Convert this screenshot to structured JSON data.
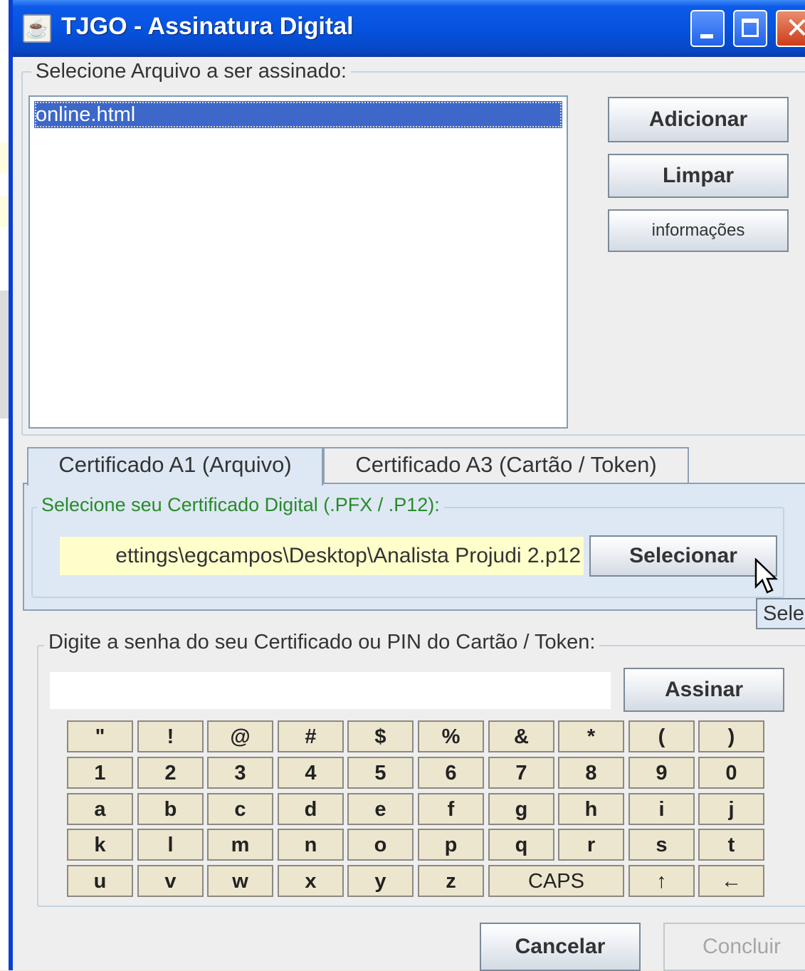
{
  "window": {
    "title": "TJGO - Assinatura Digital",
    "icon": "java-icon",
    "controls": [
      "minimize-icon",
      "maximize-icon",
      "close-icon"
    ]
  },
  "files": {
    "legend": "Selecione Arquivo a ser assinado:",
    "items": [
      "online.html"
    ],
    "selected_index": 0,
    "buttons": {
      "add": "Adicionar",
      "clear": "Limpar",
      "info": "informações"
    }
  },
  "tabs": {
    "items": [
      "Certificado A1 (Arquivo)",
      "Certificado A3 (Cartão / Token)"
    ],
    "active_index": 0
  },
  "certificate": {
    "legend": "Selecione seu Certificado Digital (.PFX / .P12):",
    "path": "ettings\\egcampos\\Desktop\\Analista Projudi 2.p12",
    "select_button": "Selecionar",
    "tooltip": "Selec"
  },
  "password": {
    "legend": "Digite a senha do seu Certificado ou PIN do Cartão / Token:",
    "value": "",
    "sign_button": "Assinar"
  },
  "keypad": {
    "rows": [
      [
        "\"",
        "!",
        "@",
        "#",
        "$",
        "%",
        "&",
        "*",
        "(",
        ")"
      ],
      [
        "1",
        "2",
        "3",
        "4",
        "5",
        "6",
        "7",
        "8",
        "9",
        "0"
      ],
      [
        "a",
        "b",
        "c",
        "d",
        "e",
        "f",
        "g",
        "h",
        "i",
        "j"
      ],
      [
        "k",
        "l",
        "m",
        "n",
        "o",
        "p",
        "q",
        "r",
        "s",
        "t"
      ],
      [
        "u",
        "v",
        "w",
        "x",
        "y",
        "z",
        "CAPS",
        "↑",
        "←"
      ]
    ]
  },
  "footer": {
    "cancel": "Cancelar",
    "finish": "Concluir"
  },
  "colors": {
    "title_bar": "#0653e0",
    "selection": "#3d67c9",
    "certificate_legend": "#2a8a2a",
    "path_field": "#ffffcc"
  }
}
